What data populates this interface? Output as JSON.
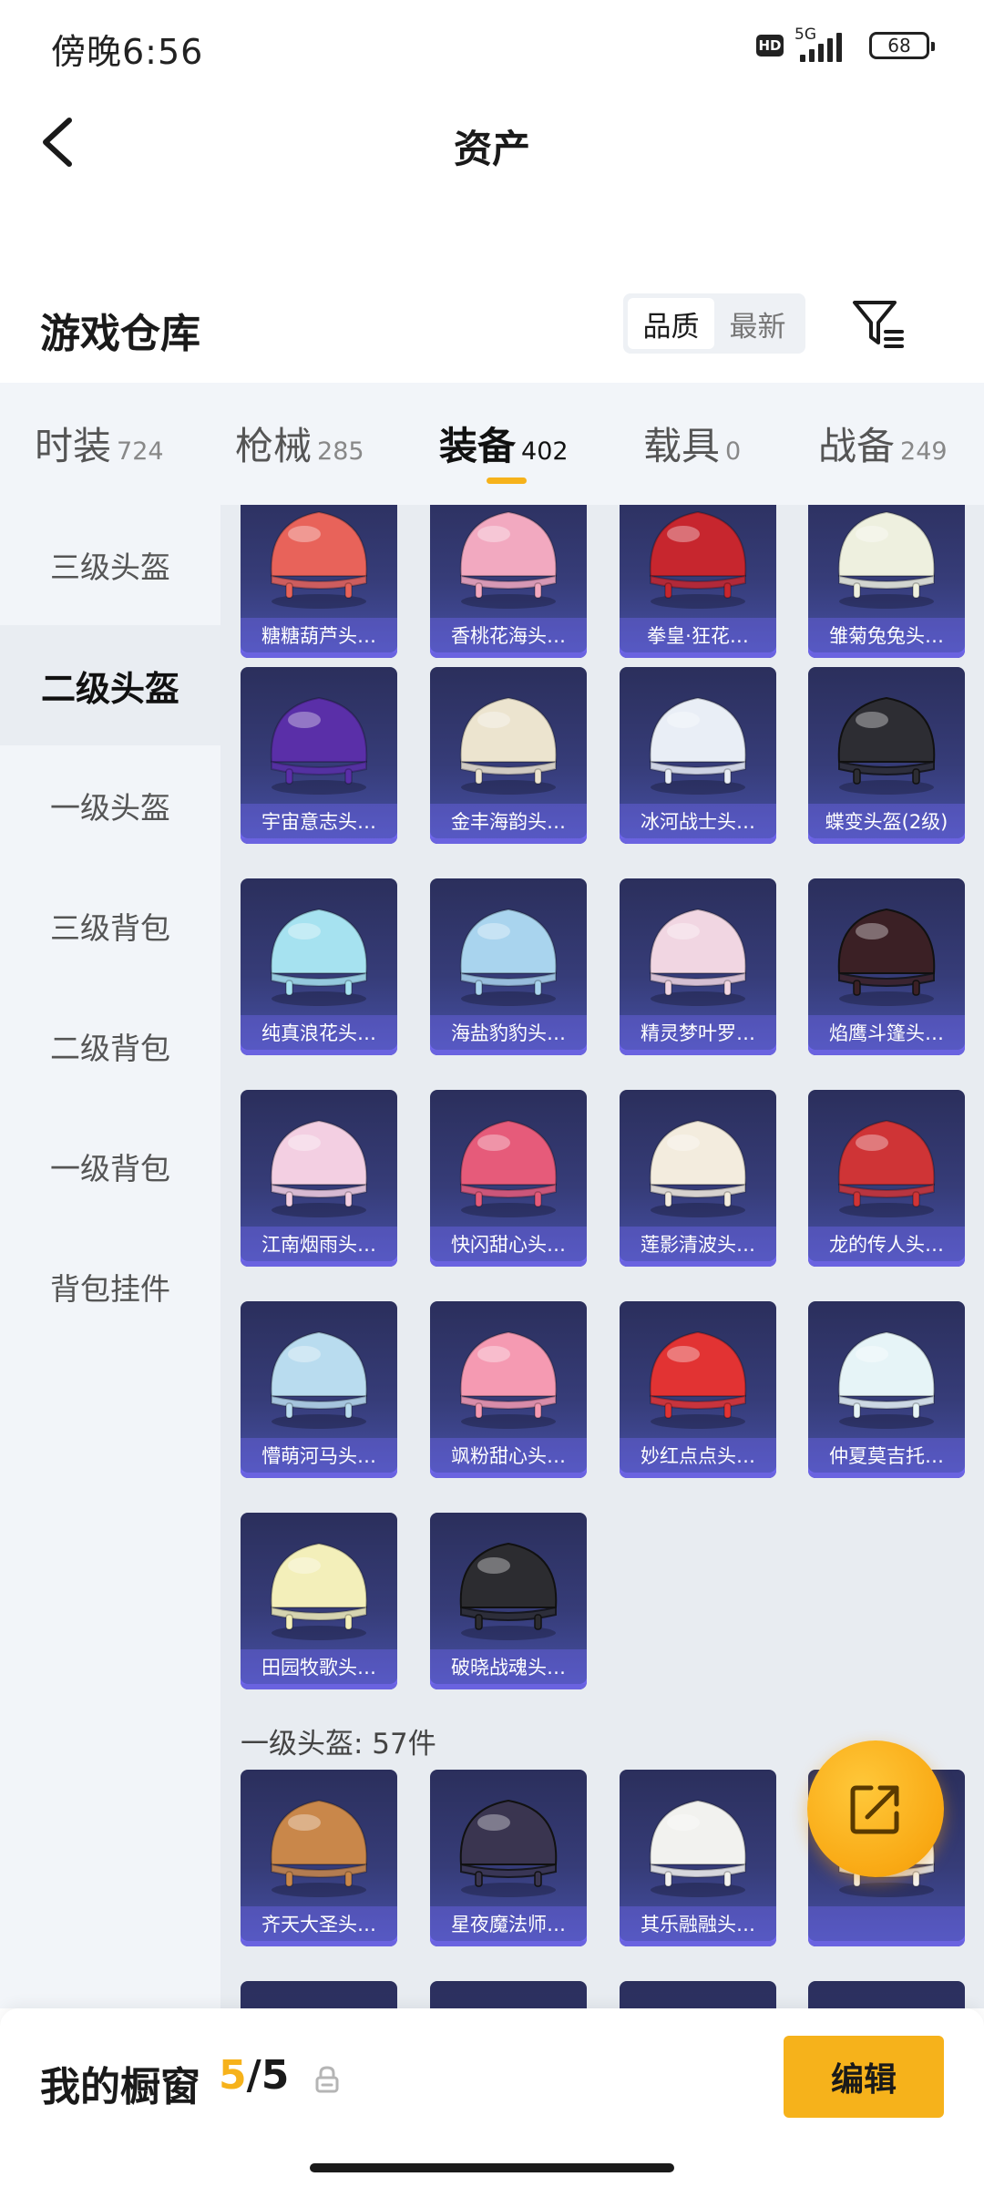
{
  "status_bar": {
    "time": "傍晚6:56",
    "hd": "HD",
    "network": "5G",
    "battery": "68"
  },
  "header": {
    "title": "资产"
  },
  "warehouse": {
    "title": "游戏仓库",
    "sort_options": [
      "品质",
      "最新"
    ],
    "selected_sort": "品质"
  },
  "tabs": [
    {
      "label": "时装",
      "count": "724"
    },
    {
      "label": "枪械",
      "count": "285"
    },
    {
      "label": "装备",
      "count": "402"
    },
    {
      "label": "载具",
      "count": "0"
    },
    {
      "label": "战备",
      "count": "249"
    }
  ],
  "active_tab": "装备",
  "sidebar": {
    "items": [
      "三级头盔",
      "二级头盔",
      "一级头盔",
      "三级背包",
      "二级背包",
      "一级背包",
      "背包挂件"
    ],
    "active": "二级头盔"
  },
  "grid": {
    "rows": [
      [
        "糖糖葫芦头…",
        "香桃花海头…",
        "拳皇·狂花…",
        "雏菊兔兔头…"
      ],
      [
        "宇宙意志头…",
        "金丰海韵头…",
        "冰河战士头…",
        "蝶变头盔(2级)"
      ],
      [
        "纯真浪花头…",
        "海盐豹豹头…",
        "精灵梦叶罗…",
        "焰鹰斗篷头…"
      ],
      [
        "江南烟雨头…",
        "快闪甜心头…",
        "莲影清波头…",
        "龙的传人头…"
      ],
      [
        "懵萌河马头…",
        "飒粉甜心头…",
        "妙红点点头…",
        "仲夏莫吉托…"
      ],
      [
        "田园牧歌头…",
        "破晓战魂头…"
      ]
    ],
    "section2_label": "一级头盔: 57件",
    "section2_items": [
      "齐天大圣头…",
      "星夜魔法师…",
      "其乐融融头…",
      ""
    ]
  },
  "helmet_colors": [
    [
      "#e8635a",
      "#f2a9c0",
      "#c7262e",
      "#eef0df"
    ],
    [
      "#5a2fa8",
      "#ece4cf",
      "#e9eef6",
      "#2d2d33"
    ],
    [
      "#a6e2f0",
      "#a9d4ee",
      "#f1d6e2",
      "#3b2025"
    ],
    [
      "#f3cfe2",
      "#e65b7a",
      "#f3ecde",
      "#cf3436"
    ],
    [
      "#b9dcef",
      "#f59ab2",
      "#e23333",
      "#e6f4f7"
    ],
    [
      "#f3efba",
      "#2c2c30"
    ]
  ],
  "section2_colors": [
    "#c9874a",
    "#3a3550",
    "#f2f2ef",
    "#f4f4f4"
  ],
  "bottom_bar": {
    "label": "我的橱窗",
    "current": "5",
    "separator": "/",
    "total": "5",
    "edit_label": "编辑"
  },
  "colors": {
    "accent": "#f6b21b",
    "card_bg": "#363c78"
  }
}
